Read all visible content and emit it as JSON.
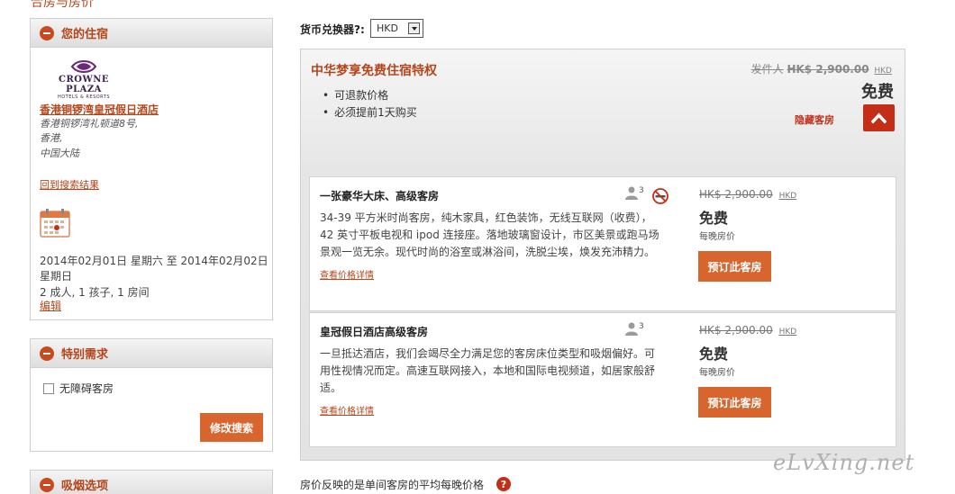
{
  "top_cut_title": "合房与房价",
  "sidebar": {
    "stay": {
      "title": "您的住宿",
      "logo_name": "CROWNE PLAZA",
      "logo_sub": "HOTELS & RESORTS",
      "hotel_name": "香港铜锣湾皇冠假日酒店",
      "address_line1": "香港铜锣湾礼顿道8号,",
      "address_line2": "香港,",
      "address_line3": "中国大陆",
      "back_link": "回到搜索结果",
      "dates": "2014年02月01日 星期六 至  2014年02月02日 星期日",
      "guests": "2 成人, 1 孩子, 1 房间",
      "edit_link": "编辑"
    },
    "special": {
      "title": "特别需求",
      "accessible_label": "无障碍客房",
      "modify_button": "修改搜索"
    },
    "smoking": {
      "title": "吸烟选项"
    }
  },
  "currency": {
    "label": "货币兑换器?:",
    "selected": "HKD"
  },
  "offer": {
    "title": "中华梦享免费住宿特权",
    "bullets": [
      "可退款价格",
      "必须提前1天购买"
    ],
    "orig_prefix": "发件人",
    "orig_price": "HK$ 2,900.00",
    "orig_currency": "HKD",
    "free_label": "免费",
    "hide_rooms": "隐藏客房",
    "rooms": [
      {
        "name": "一张豪华大床、高级客房",
        "occupancy": "3",
        "description": "34-39 平方米时尚客房，纯木家具，红色装饰，无线互联网（收费），42 英寸平板电视和 ipod 连接座。落地玻璃窗设计，市区美景或跑马场景观一览无余。现代时尚的浴室或淋浴间，洗脱尘埃，焕发充沛精力。",
        "rate_link": "查看价格详情",
        "price": "HK$ 2,900.00",
        "currency": "HKD",
        "free": "免费",
        "per_night": "每晚房价",
        "book": "预订此客房"
      },
      {
        "name": "皇冠假日酒店高级客房",
        "occupancy": "3",
        "description": "一旦抵达酒店，我们会竭尽全力满足您的客房床位类型和吸烟偏好。可用性视情况而定。高速互联网接入，本地和国际电视频道，如居家般舒适。",
        "rate_link": "查看价格详情",
        "price": "HK$ 2,900.00",
        "currency": "HKD",
        "free": "免费",
        "per_night": "每晚房价",
        "book": "预订此客房"
      }
    ]
  },
  "footer_note": "房价反映的是单间客房的平均每晚价格",
  "help_glyph": "?",
  "watermark": "eLvXing.net",
  "colors": {
    "accent": "#b5451b",
    "button": "#d9652e",
    "collapse": "#c22e16"
  }
}
